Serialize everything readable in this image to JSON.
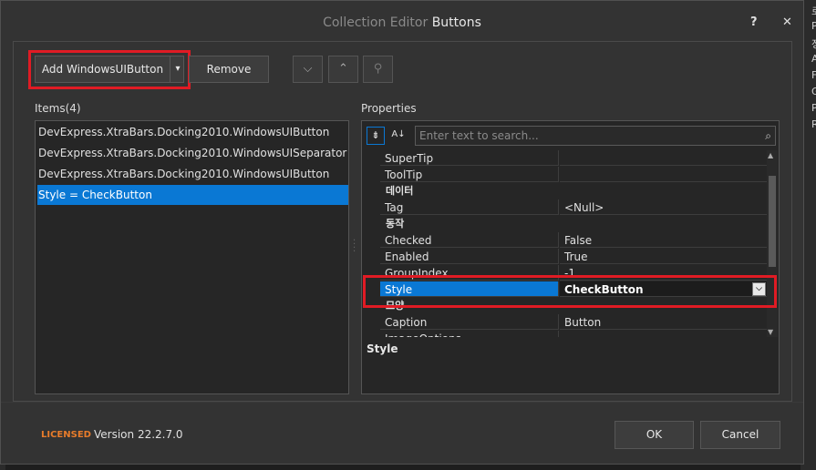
{
  "window": {
    "title_prefix": "Collection Editor",
    "title_name": "Buttons",
    "help_label": "?",
    "close_label": "✕"
  },
  "toolbar": {
    "add_label": "Add WindowsUIButton",
    "add_dropdown": "▾",
    "remove_label": "Remove",
    "move_down": "⌵",
    "move_up": "⌃",
    "search": "⚲"
  },
  "items": {
    "header": "Items(4)",
    "list": [
      "DevExpress.XtraBars.Docking2010.WindowsUIButton",
      "DevExpress.XtraBars.Docking2010.WindowsUISeparator",
      "DevExpress.XtraBars.Docking2010.WindowsUIButton",
      "Style = CheckButton"
    ],
    "selected_index": 3
  },
  "properties": {
    "header": "Properties",
    "search_placeholder": "Enter text to search...",
    "sort_categorized_icon": "⇟",
    "sort_alpha_icon": "A↓",
    "rows": [
      {
        "kind": "prop",
        "name": "SuperTip",
        "value": ""
      },
      {
        "kind": "prop",
        "name": "ToolTip",
        "value": ""
      },
      {
        "kind": "cat",
        "name": "데이터"
      },
      {
        "kind": "prop",
        "name": "Tag",
        "value": "<Null>"
      },
      {
        "kind": "cat",
        "name": "동작"
      },
      {
        "kind": "prop",
        "name": "Checked",
        "value": "False"
      },
      {
        "kind": "prop",
        "name": "Enabled",
        "value": "True"
      },
      {
        "kind": "prop",
        "name": "GroupIndex",
        "value": "-1"
      },
      {
        "kind": "prop",
        "name": "Style",
        "value": "CheckButton",
        "selected": true
      },
      {
        "kind": "cat",
        "name": "모양"
      },
      {
        "kind": "prop",
        "name": "Caption",
        "value": "Button"
      },
      {
        "kind": "prop",
        "name": "ImageOptions",
        "value": ""
      }
    ],
    "description_title": "Style"
  },
  "footer": {
    "licensed": "LICENSED",
    "version": "Version 22.2.7.0",
    "ok_label": "OK",
    "cancel_label": "Cancel"
  },
  "background_fragments": [
    "로",
    "P",
    "정",
    "A",
    "F",
    "G",
    "P",
    "R"
  ],
  "colors": {
    "accent_blue": "#0a78d4",
    "highlight_red": "#e01b24",
    "licensed_orange": "#e87c2b",
    "dialog_bg": "#333333"
  }
}
